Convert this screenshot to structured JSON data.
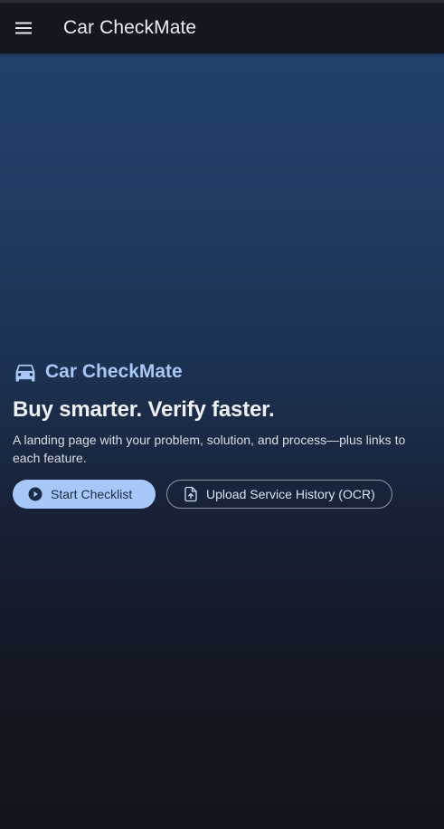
{
  "topbar": {
    "menu_icon": "menu-icon",
    "title": "Car CheckMate"
  },
  "hero": {
    "brand_icon": "car-icon",
    "brand_name": "Car CheckMate",
    "headline": "Buy smarter. Verify faster.",
    "subtext": "A landing page with your problem, solution, and process—plus links to each feature.",
    "primary_button": {
      "icon": "play-circle-icon",
      "label": "Start Checklist"
    },
    "secondary_button": {
      "icon": "file-upload-icon",
      "label": "Upload Service History (OCR)"
    }
  },
  "colors": {
    "accent": "#a7c8f8",
    "topbar_bg": "#14171d",
    "hero_gradient_top": "#25466d",
    "hero_gradient_bottom": "#12151b"
  }
}
